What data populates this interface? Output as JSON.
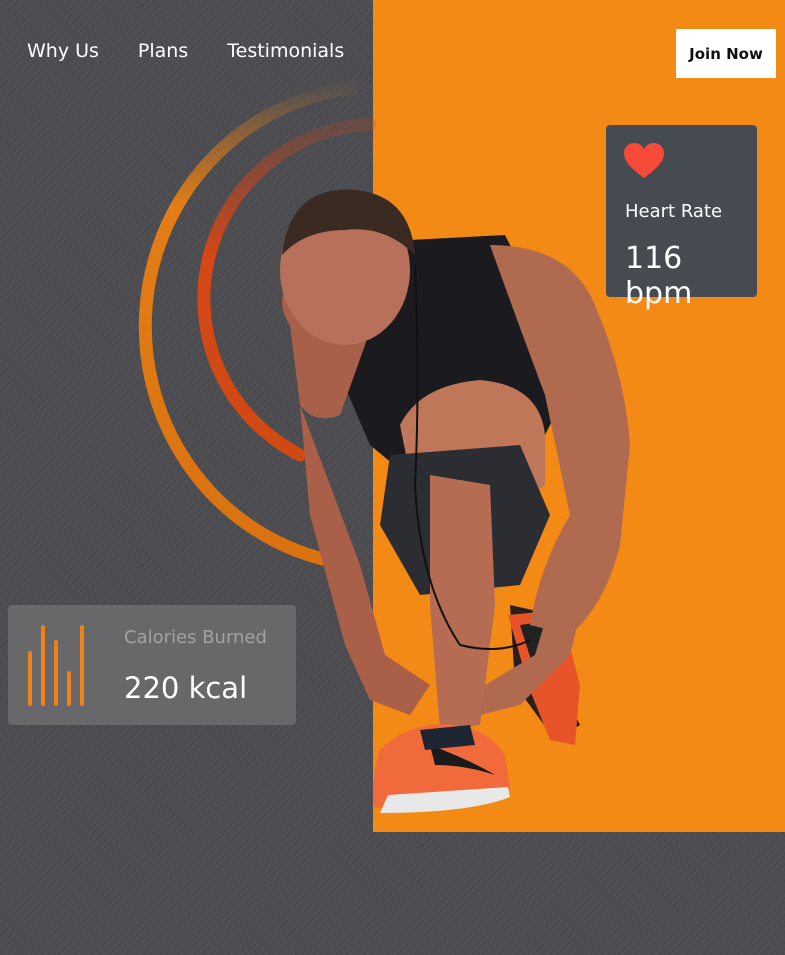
{
  "nav": {
    "items": [
      {
        "label": "Why Us"
      },
      {
        "label": "Plans"
      },
      {
        "label": "Testimonials"
      }
    ],
    "cta_label": "Join Now"
  },
  "hero": {
    "image_alt": "athlete tying running shoe laces"
  },
  "stats": {
    "heart_rate": {
      "label": "Heart Rate",
      "value": "116 bpm",
      "icon": "heart-icon"
    },
    "calories": {
      "label": "Calories Burned",
      "value": "220 kcal",
      "icon": "bar-chart-icon"
    }
  },
  "colors": {
    "accent": "#f28a15",
    "background": "#4c4c50",
    "heart": "#f74a38",
    "card_dark": "#464a51",
    "card_grey": "#68686a"
  }
}
